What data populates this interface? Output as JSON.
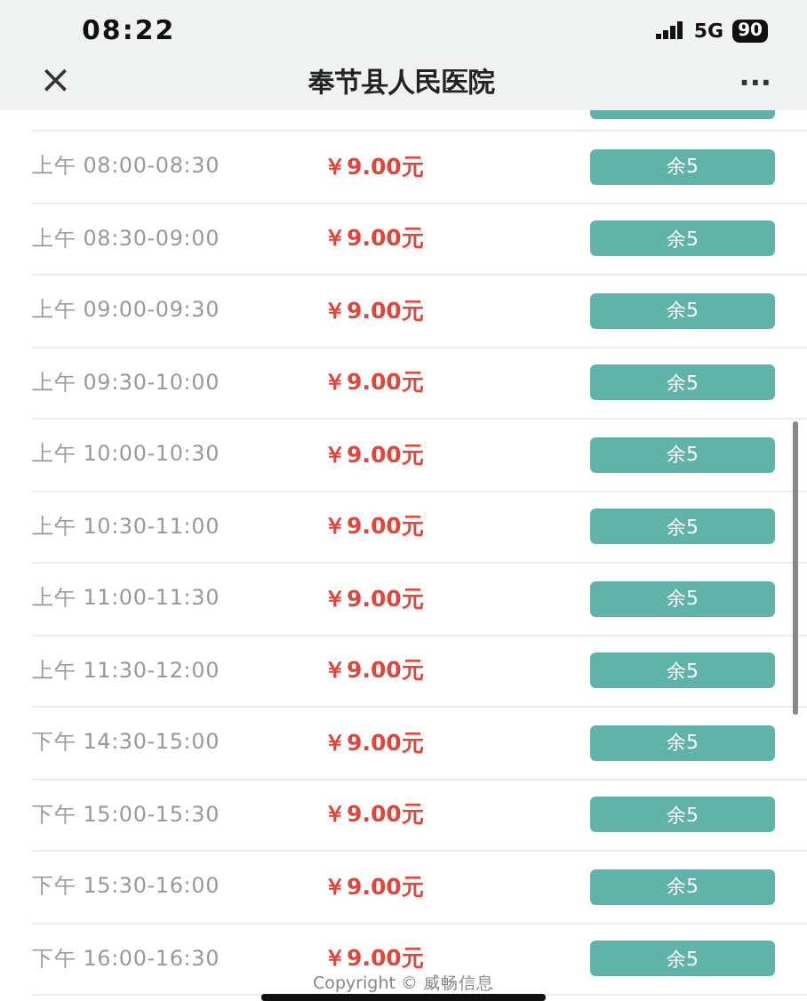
{
  "status_bar": {
    "time": "08:22",
    "network": "5G",
    "battery": "90"
  },
  "nav": {
    "close": "×",
    "title": "奉节县人民医院",
    "more": "···"
  },
  "slots": [
    {
      "time": "上午 08:00-08:30",
      "price": "￥9.00元",
      "remaining": "余5"
    },
    {
      "time": "上午 08:30-09:00",
      "price": "￥9.00元",
      "remaining": "余5"
    },
    {
      "time": "上午 09:00-09:30",
      "price": "￥9.00元",
      "remaining": "余5"
    },
    {
      "time": "上午 09:30-10:00",
      "price": "￥9.00元",
      "remaining": "余5"
    },
    {
      "time": "上午 10:00-10:30",
      "price": "￥9.00元",
      "remaining": "余5"
    },
    {
      "time": "上午 10:30-11:00",
      "price": "￥9.00元",
      "remaining": "余5"
    },
    {
      "time": "上午 11:00-11:30",
      "price": "￥9.00元",
      "remaining": "余5"
    },
    {
      "time": "上午 11:30-12:00",
      "price": "￥9.00元",
      "remaining": "余5"
    },
    {
      "time": "下午 14:30-15:00",
      "price": "￥9.00元",
      "remaining": "余5"
    },
    {
      "time": "下午 15:00-15:30",
      "price": "￥9.00元",
      "remaining": "余5"
    },
    {
      "time": "下午 15:30-16:00",
      "price": "￥9.00元",
      "remaining": "余5"
    },
    {
      "time": "下午 16:00-16:30",
      "price": "￥9.00元",
      "remaining": "余5"
    }
  ],
  "copyright": "Copyright © 威畅信息"
}
